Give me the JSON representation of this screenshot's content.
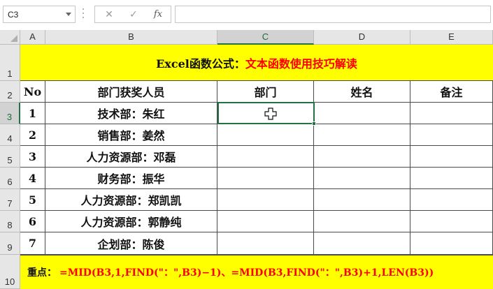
{
  "name_box": {
    "value": "C3"
  },
  "formula_bar": {
    "cancel_icon": "close-icon",
    "enter_icon": "check-icon",
    "function_label": "fx",
    "formula": ""
  },
  "columns": [
    "A",
    "B",
    "C",
    "D",
    "E"
  ],
  "rows": [
    "1",
    "2",
    "3",
    "4",
    "5",
    "6",
    "7",
    "8",
    "9",
    "10"
  ],
  "title": {
    "part1": "Excel函数公式：",
    "part2": "文本函数使用技巧解读"
  },
  "header": {
    "no": "No",
    "people": "部门获奖人员",
    "dept": "部门",
    "name": "姓名",
    "note": "备注"
  },
  "data": [
    {
      "no": "1",
      "people": "技术部：朱红"
    },
    {
      "no": "2",
      "people": "销售部：姜然"
    },
    {
      "no": "3",
      "people": "人力资源部：邓磊"
    },
    {
      "no": "4",
      "people": "财务部：振华"
    },
    {
      "no": "5",
      "people": "人力资源部：郑凯凯"
    },
    {
      "no": "6",
      "people": "人力资源部：郭静纯"
    },
    {
      "no": "7",
      "people": "企划部：陈俊"
    }
  ],
  "footer": {
    "label": "重点：",
    "formula": "=MID(B3,1,FIND(\"：\",B3)−1)、=MID(B3,FIND(\"：\",B3)+1,LEN(B3))"
  },
  "colors": {
    "highlight": "#ffff00",
    "accent_red": "#ff0000",
    "selection_green": "#217346"
  }
}
